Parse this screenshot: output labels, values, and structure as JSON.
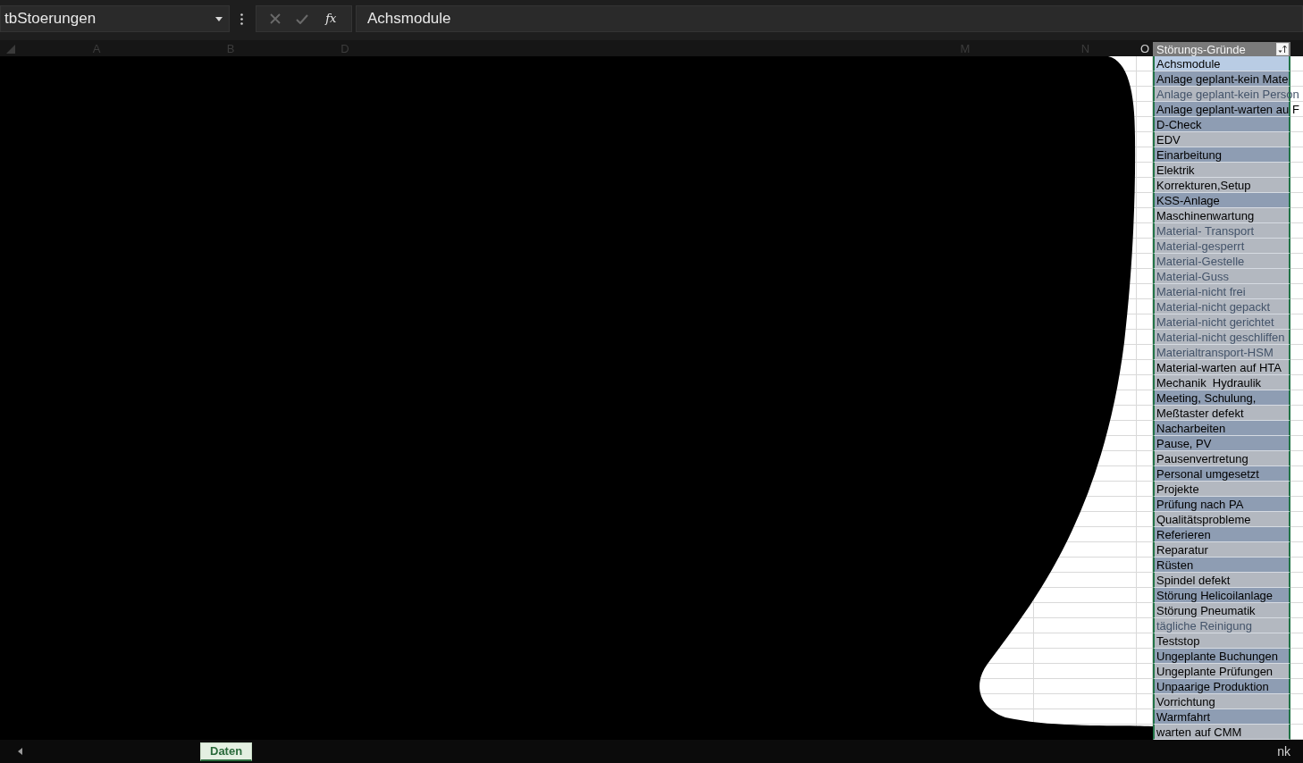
{
  "formula_bar": {
    "name_box": {
      "value": "tbStoerungen"
    },
    "buttons": [
      {
        "kind": "cancel",
        "disabled": true
      },
      {
        "kind": "enter",
        "disabled": true
      },
      {
        "kind": "function",
        "label": "fx",
        "disabled": false
      }
    ],
    "formula": {
      "value": "Achsmodule"
    }
  },
  "column_headers": [
    {
      "label": "A",
      "dimmed": true
    },
    {
      "label": "B",
      "dimmed": true
    },
    {
      "label": "D",
      "dimmed": true
    },
    {
      "label": "M",
      "dimmed": true
    },
    {
      "label": "N",
      "dimmed": true
    },
    {
      "label": "O",
      "dimmed": false
    }
  ],
  "table": {
    "header": {
      "label": "Störungs-Gründe"
    },
    "rows": [
      {
        "text": "Achsmodule",
        "selected": true,
        "shaded": false,
        "greyed": false
      },
      {
        "text": "Anlage geplant-kein Mate",
        "selected": false,
        "shaded": true,
        "greyed": false
      },
      {
        "text": "Anlage geplant-kein Person",
        "selected": false,
        "shaded": false,
        "greyed": true
      },
      {
        "text": "Anlage geplant-warten au",
        "selected": false,
        "shaded": true,
        "greyed": false,
        "adjacent_cell": "F"
      },
      {
        "text": "D-Check",
        "selected": false,
        "shaded": true,
        "greyed": false
      },
      {
        "text": "EDV",
        "selected": false,
        "shaded": false,
        "greyed": false
      },
      {
        "text": "Einarbeitung",
        "selected": false,
        "shaded": true,
        "greyed": false
      },
      {
        "text": "Elektrik",
        "selected": false,
        "shaded": false,
        "greyed": false
      },
      {
        "text": "Korrekturen,Setup",
        "selected": false,
        "shaded": false,
        "greyed": false
      },
      {
        "text": "KSS-Anlage",
        "selected": false,
        "shaded": true,
        "greyed": false
      },
      {
        "text": "Maschinenwartung",
        "selected": false,
        "shaded": false,
        "greyed": false
      },
      {
        "text": "Material- Transport",
        "selected": false,
        "shaded": false,
        "greyed": true
      },
      {
        "text": "Material-gesperrt",
        "selected": false,
        "shaded": false,
        "greyed": true
      },
      {
        "text": "Material-Gestelle",
        "selected": false,
        "shaded": false,
        "greyed": true
      },
      {
        "text": "Material-Guss",
        "selected": false,
        "shaded": false,
        "greyed": true
      },
      {
        "text": "Material-nicht frei",
        "selected": false,
        "shaded": false,
        "greyed": true
      },
      {
        "text": "Material-nicht gepackt",
        "selected": false,
        "shaded": false,
        "greyed": true
      },
      {
        "text": "Material-nicht gerichtet",
        "selected": false,
        "shaded": false,
        "greyed": true
      },
      {
        "text": "Material-nicht geschliffen",
        "selected": false,
        "shaded": false,
        "greyed": true
      },
      {
        "text": "Materialtransport-HSM",
        "selected": false,
        "shaded": false,
        "greyed": true
      },
      {
        "text": "Material-warten auf HTA",
        "selected": false,
        "shaded": false,
        "greyed": false
      },
      {
        "text": "Mechanik  Hydraulik",
        "selected": false,
        "shaded": false,
        "greyed": false
      },
      {
        "text": "Meeting, Schulung,",
        "selected": false,
        "shaded": true,
        "greyed": false
      },
      {
        "text": "Meßtaster defekt",
        "selected": false,
        "shaded": false,
        "greyed": false
      },
      {
        "text": "Nacharbeiten",
        "selected": false,
        "shaded": true,
        "greyed": false
      },
      {
        "text": "Pause, PV",
        "selected": false,
        "shaded": true,
        "greyed": false
      },
      {
        "text": "Pausenvertretung",
        "selected": false,
        "shaded": false,
        "greyed": false
      },
      {
        "text": "Personal umgesetzt",
        "selected": false,
        "shaded": true,
        "greyed": false
      },
      {
        "text": "Projekte",
        "selected": false,
        "shaded": false,
        "greyed": false
      },
      {
        "text": "Prüfung nach PA",
        "selected": false,
        "shaded": true,
        "greyed": false
      },
      {
        "text": "Qualitätsprobleme",
        "selected": false,
        "shaded": false,
        "greyed": false
      },
      {
        "text": "Referieren",
        "selected": false,
        "shaded": true,
        "greyed": false
      },
      {
        "text": "Reparatur",
        "selected": false,
        "shaded": false,
        "greyed": false
      },
      {
        "text": "Rüsten",
        "selected": false,
        "shaded": true,
        "greyed": false
      },
      {
        "text": "Spindel defekt",
        "selected": false,
        "shaded": false,
        "greyed": false
      },
      {
        "text": "Störung Helicoilanlage",
        "selected": false,
        "shaded": true,
        "greyed": false
      },
      {
        "text": "Störung Pneumatik",
        "selected": false,
        "shaded": false,
        "greyed": false
      },
      {
        "text": "tägliche Reinigung",
        "selected": false,
        "shaded": false,
        "greyed": true
      },
      {
        "text": "Teststop",
        "selected": false,
        "shaded": false,
        "greyed": false
      },
      {
        "text": "Ungeplante Buchungen",
        "selected": false,
        "shaded": true,
        "greyed": false
      },
      {
        "text": "Ungeplante Prüfungen",
        "selected": false,
        "shaded": false,
        "greyed": false
      },
      {
        "text": "Unpaarige Produktion",
        "selected": false,
        "shaded": true,
        "greyed": false
      },
      {
        "text": "Vorrichtung",
        "selected": false,
        "shaded": false,
        "greyed": false
      },
      {
        "text": "Warmfahrt",
        "selected": false,
        "shaded": true,
        "greyed": false
      },
      {
        "text": "warten auf CMM",
        "selected": false,
        "shaded": false,
        "greyed": false
      }
    ]
  },
  "sheet_tabs": [
    {
      "label": "Daten",
      "selected": true
    }
  ],
  "status_bar": {
    "text": "nk"
  }
}
